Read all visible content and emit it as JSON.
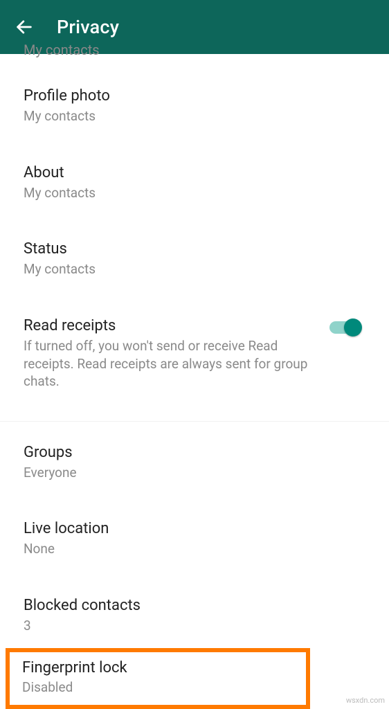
{
  "appbar": {
    "title": "Privacy"
  },
  "cut": {
    "value": "My contacts"
  },
  "items": {
    "profile_photo": {
      "title": "Profile photo",
      "value": "My contacts"
    },
    "about": {
      "title": "About",
      "value": "My contacts"
    },
    "status": {
      "title": "Status",
      "value": "My contacts"
    },
    "read_receipts": {
      "title": "Read receipts",
      "desc": "If turned off, you won't send or receive Read receipts. Read receipts are always sent for group chats."
    },
    "groups": {
      "title": "Groups",
      "value": "Everyone"
    },
    "live_location": {
      "title": "Live location",
      "value": "None"
    },
    "blocked": {
      "title": "Blocked contacts",
      "value": "3"
    },
    "fingerprint": {
      "title": "Fingerprint lock",
      "value": "Disabled"
    }
  },
  "watermark": "wsxdn.com"
}
